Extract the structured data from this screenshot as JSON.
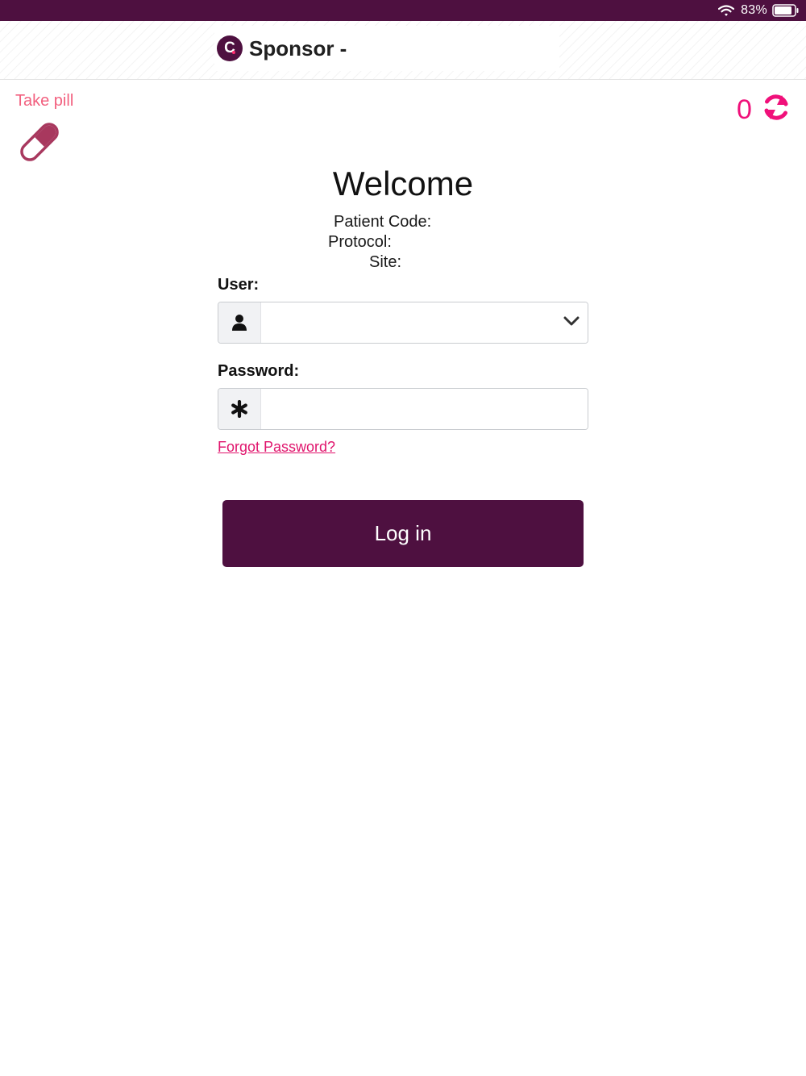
{
  "status_bar": {
    "battery_percent": "83%"
  },
  "header": {
    "title": "Sponsor -",
    "logo_letter": "C"
  },
  "actions": {
    "take_pill_label": "Take pill",
    "sync_count": "0"
  },
  "welcome": {
    "title": "Welcome",
    "patient_code_label": "Patient Code:",
    "protocol_label": "Protocol:",
    "site_label": "Site:"
  },
  "form": {
    "user_label": "User:",
    "user_value": "",
    "password_label": "Password:",
    "password_value": "",
    "forgot_password": "Forgot Password?",
    "login_button": "Log in"
  },
  "colors": {
    "brand": "#4e1040",
    "accent_pink": "#f0107a",
    "take_pill_text": "#f2607f",
    "pill_icon": "#a8385e"
  },
  "icons": [
    "wifi-icon",
    "battery-icon",
    "logo-icon",
    "pill-icon",
    "sync-icon",
    "user-icon",
    "asterisk-icon",
    "chevron-down-icon"
  ]
}
